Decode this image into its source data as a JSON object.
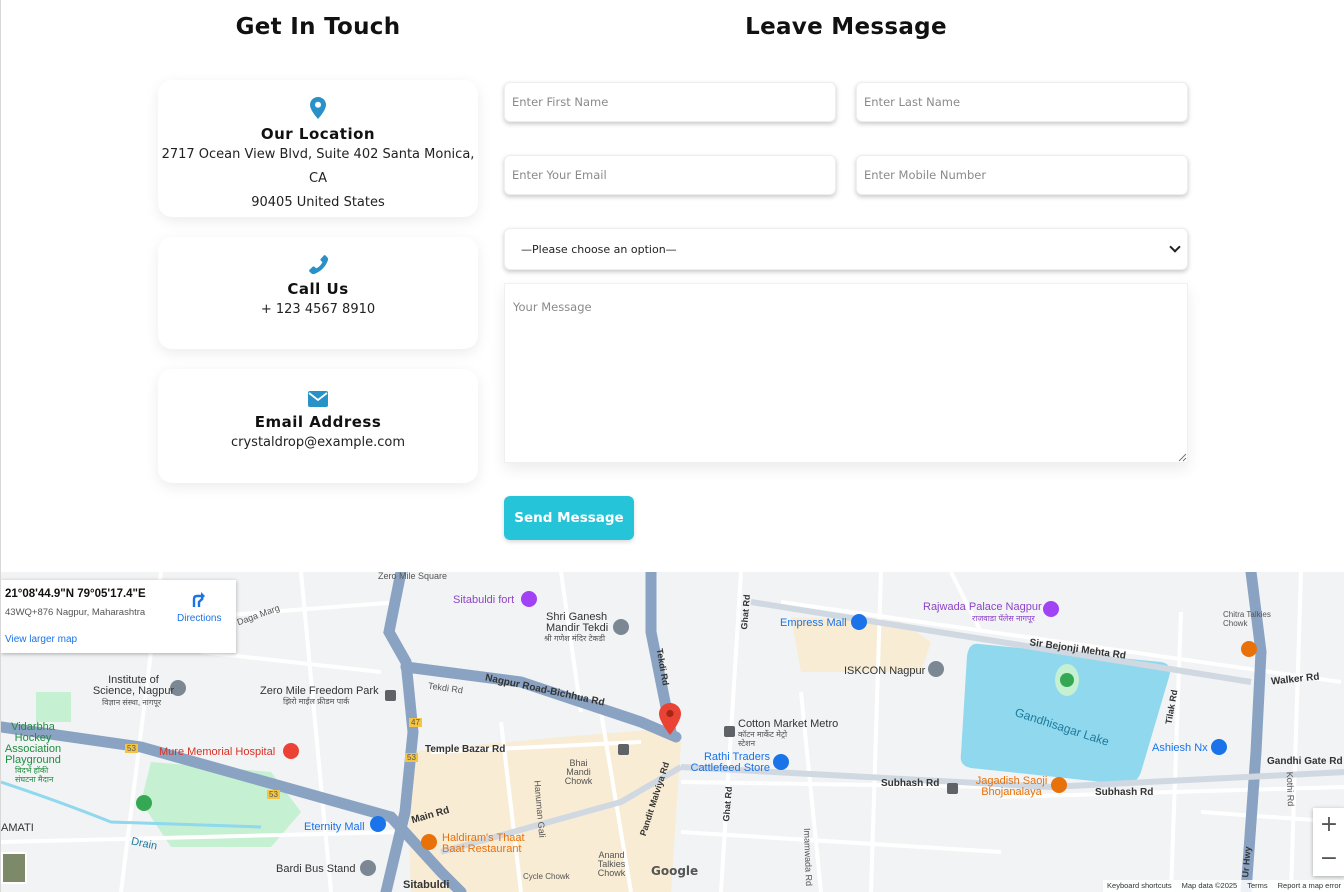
{
  "headings": {
    "get_in_touch": "Get In Touch",
    "leave_message": "Leave Message"
  },
  "cards": {
    "location": {
      "title": "Our Location",
      "line1": "2717 Ocean View Blvd, Suite 402 Santa Monica, CA",
      "line2": "90405 United States",
      "icon": "map-marker-icon"
    },
    "call": {
      "title": "Call Us",
      "line1": "+ 123 4567 8910",
      "icon": "phone-icon"
    },
    "email": {
      "title": "Email Address",
      "line1": "crystaldrop@example.com",
      "icon": "envelope-icon"
    }
  },
  "form": {
    "first_name_placeholder": "Enter First Name",
    "last_name_placeholder": "Enter Last Name",
    "email_placeholder": "Enter Your Email",
    "mobile_placeholder": "Enter Mobile Number",
    "select_value": "—Please choose an option—",
    "message_placeholder": "Your Message",
    "send_label": "Send Message"
  },
  "colors": {
    "accent": "#26c4d8",
    "icon_blue": "#2891c8",
    "map_lake": "#8fd8ee",
    "map_park": "#c5f0d2"
  },
  "map": {
    "coords": "21°08'44.9\"N 79°05'17.4\"E",
    "address": "43WQ+876 Nagpur, Maharashtra",
    "view_larger": "View larger map",
    "directions": "Directions",
    "zoom_in": "+",
    "zoom_out": "−",
    "google": "Google",
    "footer": {
      "shortcuts": "Keyboard shortcuts",
      "data": "Map data ©2025",
      "terms": "Terms",
      "report": "Report a map error"
    },
    "labels": {
      "sitabuldi_fort": "Sitabuldi fort",
      "zero_mile_square": "Zero Mile Square",
      "shri_ganesh": "Shri Ganesh Mandir Tekdi",
      "shri_ganesh_hi": "श्री गणेश मंदिर टेकडी",
      "empress_mall": "Empress Mall",
      "rajwada": "Rajwada Palace Nagpur",
      "rajwada_hi": "राजवाडा पॅलेस नागपूर",
      "chitra_talkies": "Chitra Talkies Chowk",
      "institute": "Institute of Science, Nagpur",
      "institute_hi": "विज्ञान संस्था, नागपूर",
      "zero_mile_park": "Zero Mile Freedom Park",
      "zero_mile_park_hi": "झिरो माईल फ्रीडम पार्क",
      "iskcon": "ISKCON Nagpur",
      "sir_bejonji": "Sir Bejonji Mehta Rd",
      "walker_rd": "Walker Rd",
      "nagpur_road": "Nagpur Road-Bichhua Rd",
      "tekdi_rd": "Tekdi Rd",
      "temple_bazar": "Temple Bazar Rd",
      "cotton_market": "Cotton Market Metro",
      "cotton_market_hi": "कॉटन मार्केट मेट्रो स्टेशन",
      "vidarbha": "Vidarbha Hockey Association Playground",
      "vidarbha_hi": "विदर्भ हॉकी संघटना मैदान",
      "mure": "Mure Memorial Hospital",
      "rathi": "Rathi Traders Cattlefeed Store",
      "gandhisagar": "Gandhisagar Lake",
      "ashiesh": "Ashiesh Nx",
      "gandhi_gate": "Gandhi Gate Rd",
      "subhash_rd": "Subhash Rd",
      "jagadish": "Jagadish Saoji Bhojanalaya",
      "eternity": "Eternity Mall",
      "haldiram": "Haldiram's Thaat Baat Restaurant",
      "bardi": "Bardi Bus Stand",
      "sitabuldi": "Sitabuldi",
      "main_rd": "Main Rd",
      "drain": "Drain",
      "amati": "AMATI",
      "ghat_rd": "Ghat Rd",
      "tilak_rd": "Tilak Rd",
      "pandit_malviya": "Pandit Malviya Rd",
      "hanuman_gali": "Hanuman Gali",
      "bhai_mandi": "Bhai Mandi Chowk",
      "anand_talkies": "Anand Talkies Chowk",
      "cycle_chowk": "Cycle Chowk",
      "umarwada": "Imamwada Rd",
      "kothi_rd": "Kothi Rd",
      "tekdi_rd_v": "Tekdi Rd",
      "dagamarg": "Daga Marg",
      "hwy": "Ur Hwy",
      "r53a": "53",
      "r53b": "53",
      "r47": "47",
      "r53c": "53"
    }
  }
}
